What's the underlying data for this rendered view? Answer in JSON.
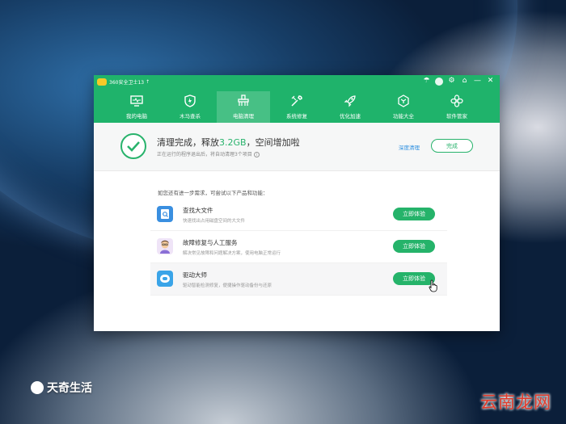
{
  "window": {
    "app_title": "360安全卫士13",
    "nav": [
      {
        "label": "我的电脑",
        "icon": "monitor-icon"
      },
      {
        "label": "木马查杀",
        "icon": "shield-icon"
      },
      {
        "label": "电脑清理",
        "icon": "broom-icon",
        "active": true
      },
      {
        "label": "系统修复",
        "icon": "wrench-icon"
      },
      {
        "label": "优化加速",
        "icon": "rocket-icon"
      },
      {
        "label": "功能大全",
        "icon": "cube-icon"
      },
      {
        "label": "软件管家",
        "icon": "flower-icon"
      }
    ]
  },
  "result": {
    "title_prefix": "清理完成，释放",
    "size": "3.2GB",
    "title_suffix": "，空间增加啦",
    "subtitle": "正在运行的程序退出后，将自动清理3个项目",
    "deep_clean_label": "深度清理",
    "done_label": "完成"
  },
  "hint": "如您还有进一步需求，可尝试以下产品和功能：",
  "features": [
    {
      "title": "查找大文件",
      "desc": "快速找出占用磁盘空间的大文件",
      "button": "立即体验",
      "icon": "file-icon",
      "color": "#3a8fe0"
    },
    {
      "title": "故障修复与人工服务",
      "desc": "解决常见故障和问题解决方案，使用电脑正常运行",
      "button": "立即体验",
      "icon": "person-icon",
      "color": "#8a6fd6"
    },
    {
      "title": "驱动大师",
      "desc": "驱动智能检测修复，便捷操作驱动备份与还原",
      "button": "立即体验",
      "icon": "driver-icon",
      "color": "#3aa4e8"
    }
  ],
  "watermarks": {
    "left": "天奇生活",
    "right": "云南龙网"
  },
  "colors": {
    "brand_green": "#1fb36b",
    "accent_green": "#28b36c",
    "link_blue": "#2a8ee0"
  }
}
